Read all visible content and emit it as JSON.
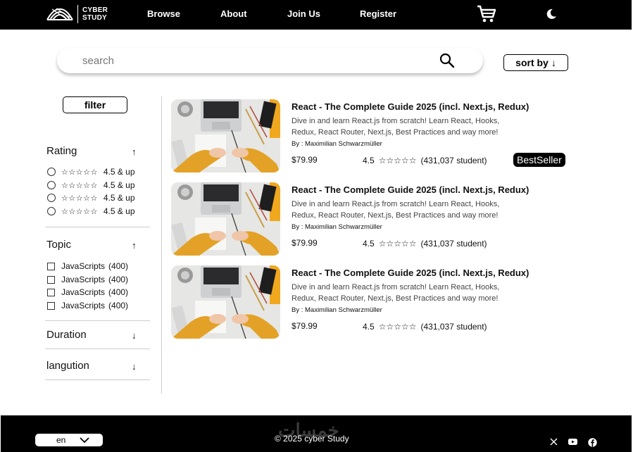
{
  "header": {
    "logo_line1": "CYBER",
    "logo_line2": "STUDY",
    "nav": [
      "Browse",
      "About",
      "Join Us",
      "Register"
    ]
  },
  "search": {
    "placeholder": "search",
    "sort_label": "sort by",
    "sort_arrow": "↓"
  },
  "sidebar": {
    "filter_label": "filter",
    "rating": {
      "title": "Rating",
      "arrow": "↑",
      "options": [
        {
          "stars": "☆☆☆☆☆",
          "label": "4.5 & up"
        },
        {
          "stars": "☆☆☆☆☆",
          "label": "4.5 & up"
        },
        {
          "stars": "☆☆☆☆☆",
          "label": "4.5 & up"
        },
        {
          "stars": "☆☆☆☆☆",
          "label": "4.5 & up"
        }
      ]
    },
    "topic": {
      "title": "Topic",
      "arrow": "↑",
      "options": [
        {
          "label": "JavaScripts",
          "count": "(400)"
        },
        {
          "label": "JavaScripts",
          "count": "(400)"
        },
        {
          "label": "JavaScripts",
          "count": "(400)"
        },
        {
          "label": "JavaScripts",
          "count": "(400)"
        }
      ]
    },
    "duration": {
      "title": "Duration",
      "arrow": "↓"
    },
    "language": {
      "title": "langution",
      "arrow": "↓"
    }
  },
  "courses": [
    {
      "title": "React - The Complete Guide 2025 (incl. Next.js, Redux)",
      "desc_line1": "Dive in and learn React.js from scratch! Learn React, Hooks,",
      "desc_line2": "Redux, React Router, Next.js, Best Practices and way more!",
      "author": "By : Maximilian Schwarzmüller",
      "price": "$79.99",
      "rating": "4.5",
      "stars": "☆☆☆☆☆",
      "students": "(431,037 student)",
      "badge": "BestSeller"
    },
    {
      "title": "React - The Complete Guide 2025 (incl. Next.js, Redux)",
      "desc_line1": "Dive in and learn React.js from scratch! Learn React, Hooks,",
      "desc_line2": "Redux, React Router, Next.js, Best Practices and way more!",
      "author": "By : Maximilian Schwarzmüller",
      "price": "$79.99",
      "rating": "4.5",
      "stars": "☆☆☆☆☆",
      "students": "(431,037 student)"
    },
    {
      "title": "React - The Complete Guide 2025 (incl. Next.js, Redux)",
      "desc_line1": "Dive in and learn React.js from scratch! Learn React, Hooks,",
      "desc_line2": "Redux, React Router, Next.js, Best Practices and way more!",
      "author": "By : Maximilian Schwarzmüller",
      "price": "$79.99",
      "rating": "4.5",
      "stars": "☆☆☆☆☆",
      "students": "(431,037 student)"
    }
  ],
  "footer": {
    "language": "en",
    "watermark": "خمسات",
    "copyright": "© 2025 cyber Study"
  },
  "colors": {
    "header_bg": "#000000",
    "footer_bg": "#000000",
    "thumb_accent": "#f0a81e",
    "badge_bg": "#000000"
  },
  "icons": [
    "logo-icon",
    "cart-icon",
    "moon-icon",
    "search-icon",
    "chevron-down-icon",
    "x-icon",
    "youtube-icon",
    "facebook-icon"
  ]
}
